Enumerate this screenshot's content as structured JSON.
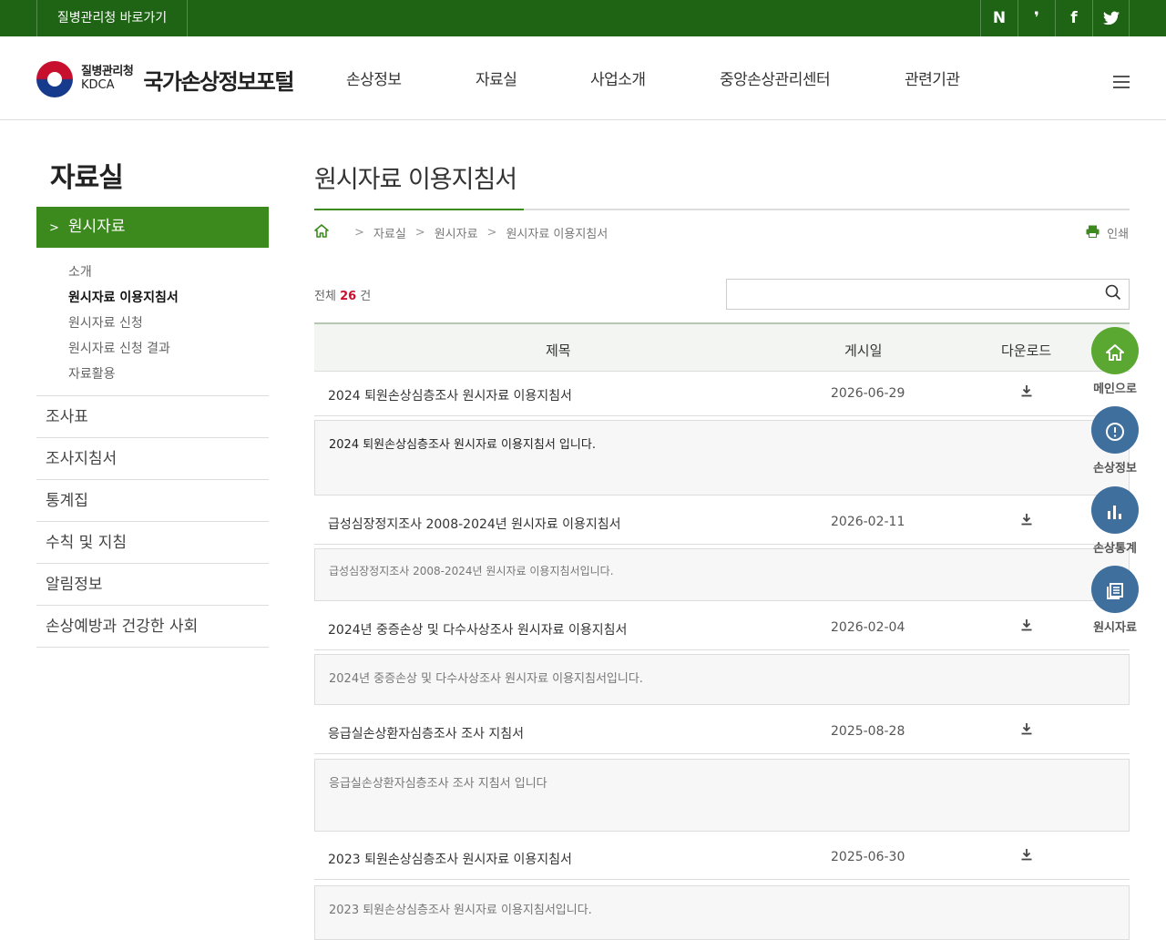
{
  "topbar": {
    "shortcut": "질병관리청 바로가기",
    "social": [
      "N",
      "❜",
      "f",
      "🐦"
    ]
  },
  "header": {
    "logo_ko": "질병관리청",
    "logo_en": "KDCA",
    "portal_title": "국가손상정보포털",
    "gnb": [
      "손상정보",
      "자료실",
      "사업소개",
      "중앙손상관리센터",
      "관련기관"
    ]
  },
  "sidebar": {
    "title": "자료실",
    "active": "원시자료",
    "sub": [
      "소개",
      "원시자료 이용지침서",
      "원시자료 신청",
      "원시자료 신청 결과",
      "자료활용"
    ],
    "items": [
      "조사표",
      "조사지침서",
      "통계집",
      "수칙 및 지침",
      "알림정보",
      "손상예방과 건강한 사회"
    ]
  },
  "main": {
    "page_title": "원시자료 이용지침서",
    "breadcrumb": [
      "자료실",
      "원시자료",
      "원시자료 이용지침서"
    ],
    "print": "인쇄",
    "total_prefix": "전체",
    "total_count": "26",
    "total_suffix": "건",
    "search_placeholder": "",
    "columns": [
      "제목",
      "게시일",
      "다운로드"
    ],
    "rows": [
      {
        "title": "2024 퇴원손상심층조사 원시자료 이용지침서",
        "date": "2026-06-29",
        "desc": "2024 퇴원손상심층조사 원시자료 이용지침서 입니다."
      },
      {
        "title": "급성심장정지조사 2008-2024년 원시자료 이용지침서",
        "date": "2026-02-11",
        "desc": "급성심장정지조사 2008-2024년 원시자료 이용지침서입니다."
      },
      {
        "title": "2024년 중증손상 및 다수사상조사 원시자료 이용지침서",
        "date": "2026-02-04",
        "desc": "2024년 중증손상 및 다수사상조사 원시자료 이용지침서입니다."
      },
      {
        "title": "응급실손상환자심층조사 조사 지침서",
        "date": "2025-08-28",
        "desc": "응급실손상환자심층조사 조사 지침서 입니다"
      },
      {
        "title": "2023 퇴원손상심층조사 원시자료 이용지침서",
        "date": "2025-06-30",
        "desc": "2023 퇴원손상심층조사 원시자료 이용지침서입니다."
      }
    ]
  },
  "quick_menu": [
    {
      "label": "메인으로",
      "icon": "home-icon",
      "color": "#5aa832"
    },
    {
      "label": "손상정보",
      "icon": "alert-icon",
      "color": "#3f6f9c"
    },
    {
      "label": "손상통계",
      "icon": "bar-chart-icon",
      "color": "#3f6f9c"
    },
    {
      "label": "원시자료",
      "icon": "document-icon",
      "color": "#3f6f9c"
    }
  ],
  "colors": {
    "brand_green": "#1e6414",
    "accent_green": "#3c8a1e",
    "count_red": "#c7102e",
    "quick_blue": "#3f6f9c"
  }
}
